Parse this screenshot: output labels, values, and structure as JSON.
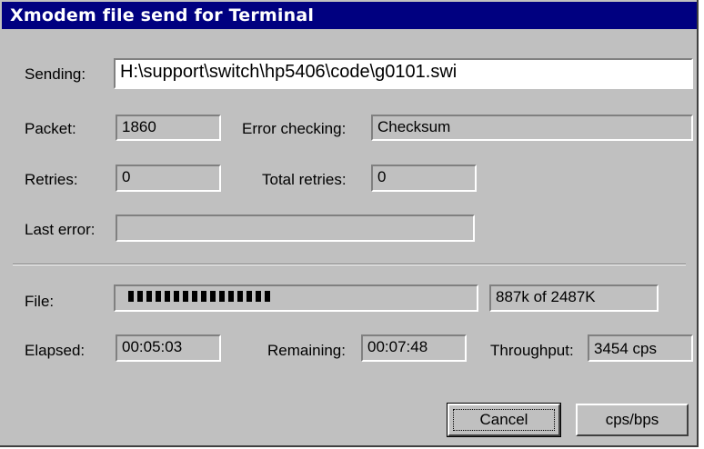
{
  "window": {
    "title": "Xmodem file send for Terminal"
  },
  "sending": {
    "label": "Sending:",
    "value": "H:\\support\\switch\\hp5406\\code\\g0101.swi"
  },
  "packet": {
    "label": "Packet:",
    "value": "1860"
  },
  "error_checking": {
    "label": "Error checking:",
    "value": "Checksum"
  },
  "retries": {
    "label": "Retries:",
    "value": "0"
  },
  "total_retries": {
    "label": "Total retries:",
    "value": "0"
  },
  "last_error": {
    "label": "Last error:",
    "value": ""
  },
  "file": {
    "label": "File:",
    "progress_fraction": 0.36,
    "status": "887k of 2487K"
  },
  "elapsed": {
    "label": "Elapsed:",
    "value": "00:05:03"
  },
  "remaining": {
    "label": "Remaining:",
    "value": "00:07:48"
  },
  "throughput": {
    "label": "Throughput:",
    "value": "3454 cps"
  },
  "buttons": {
    "cancel": "Cancel",
    "cps_bps": "cps/bps"
  }
}
